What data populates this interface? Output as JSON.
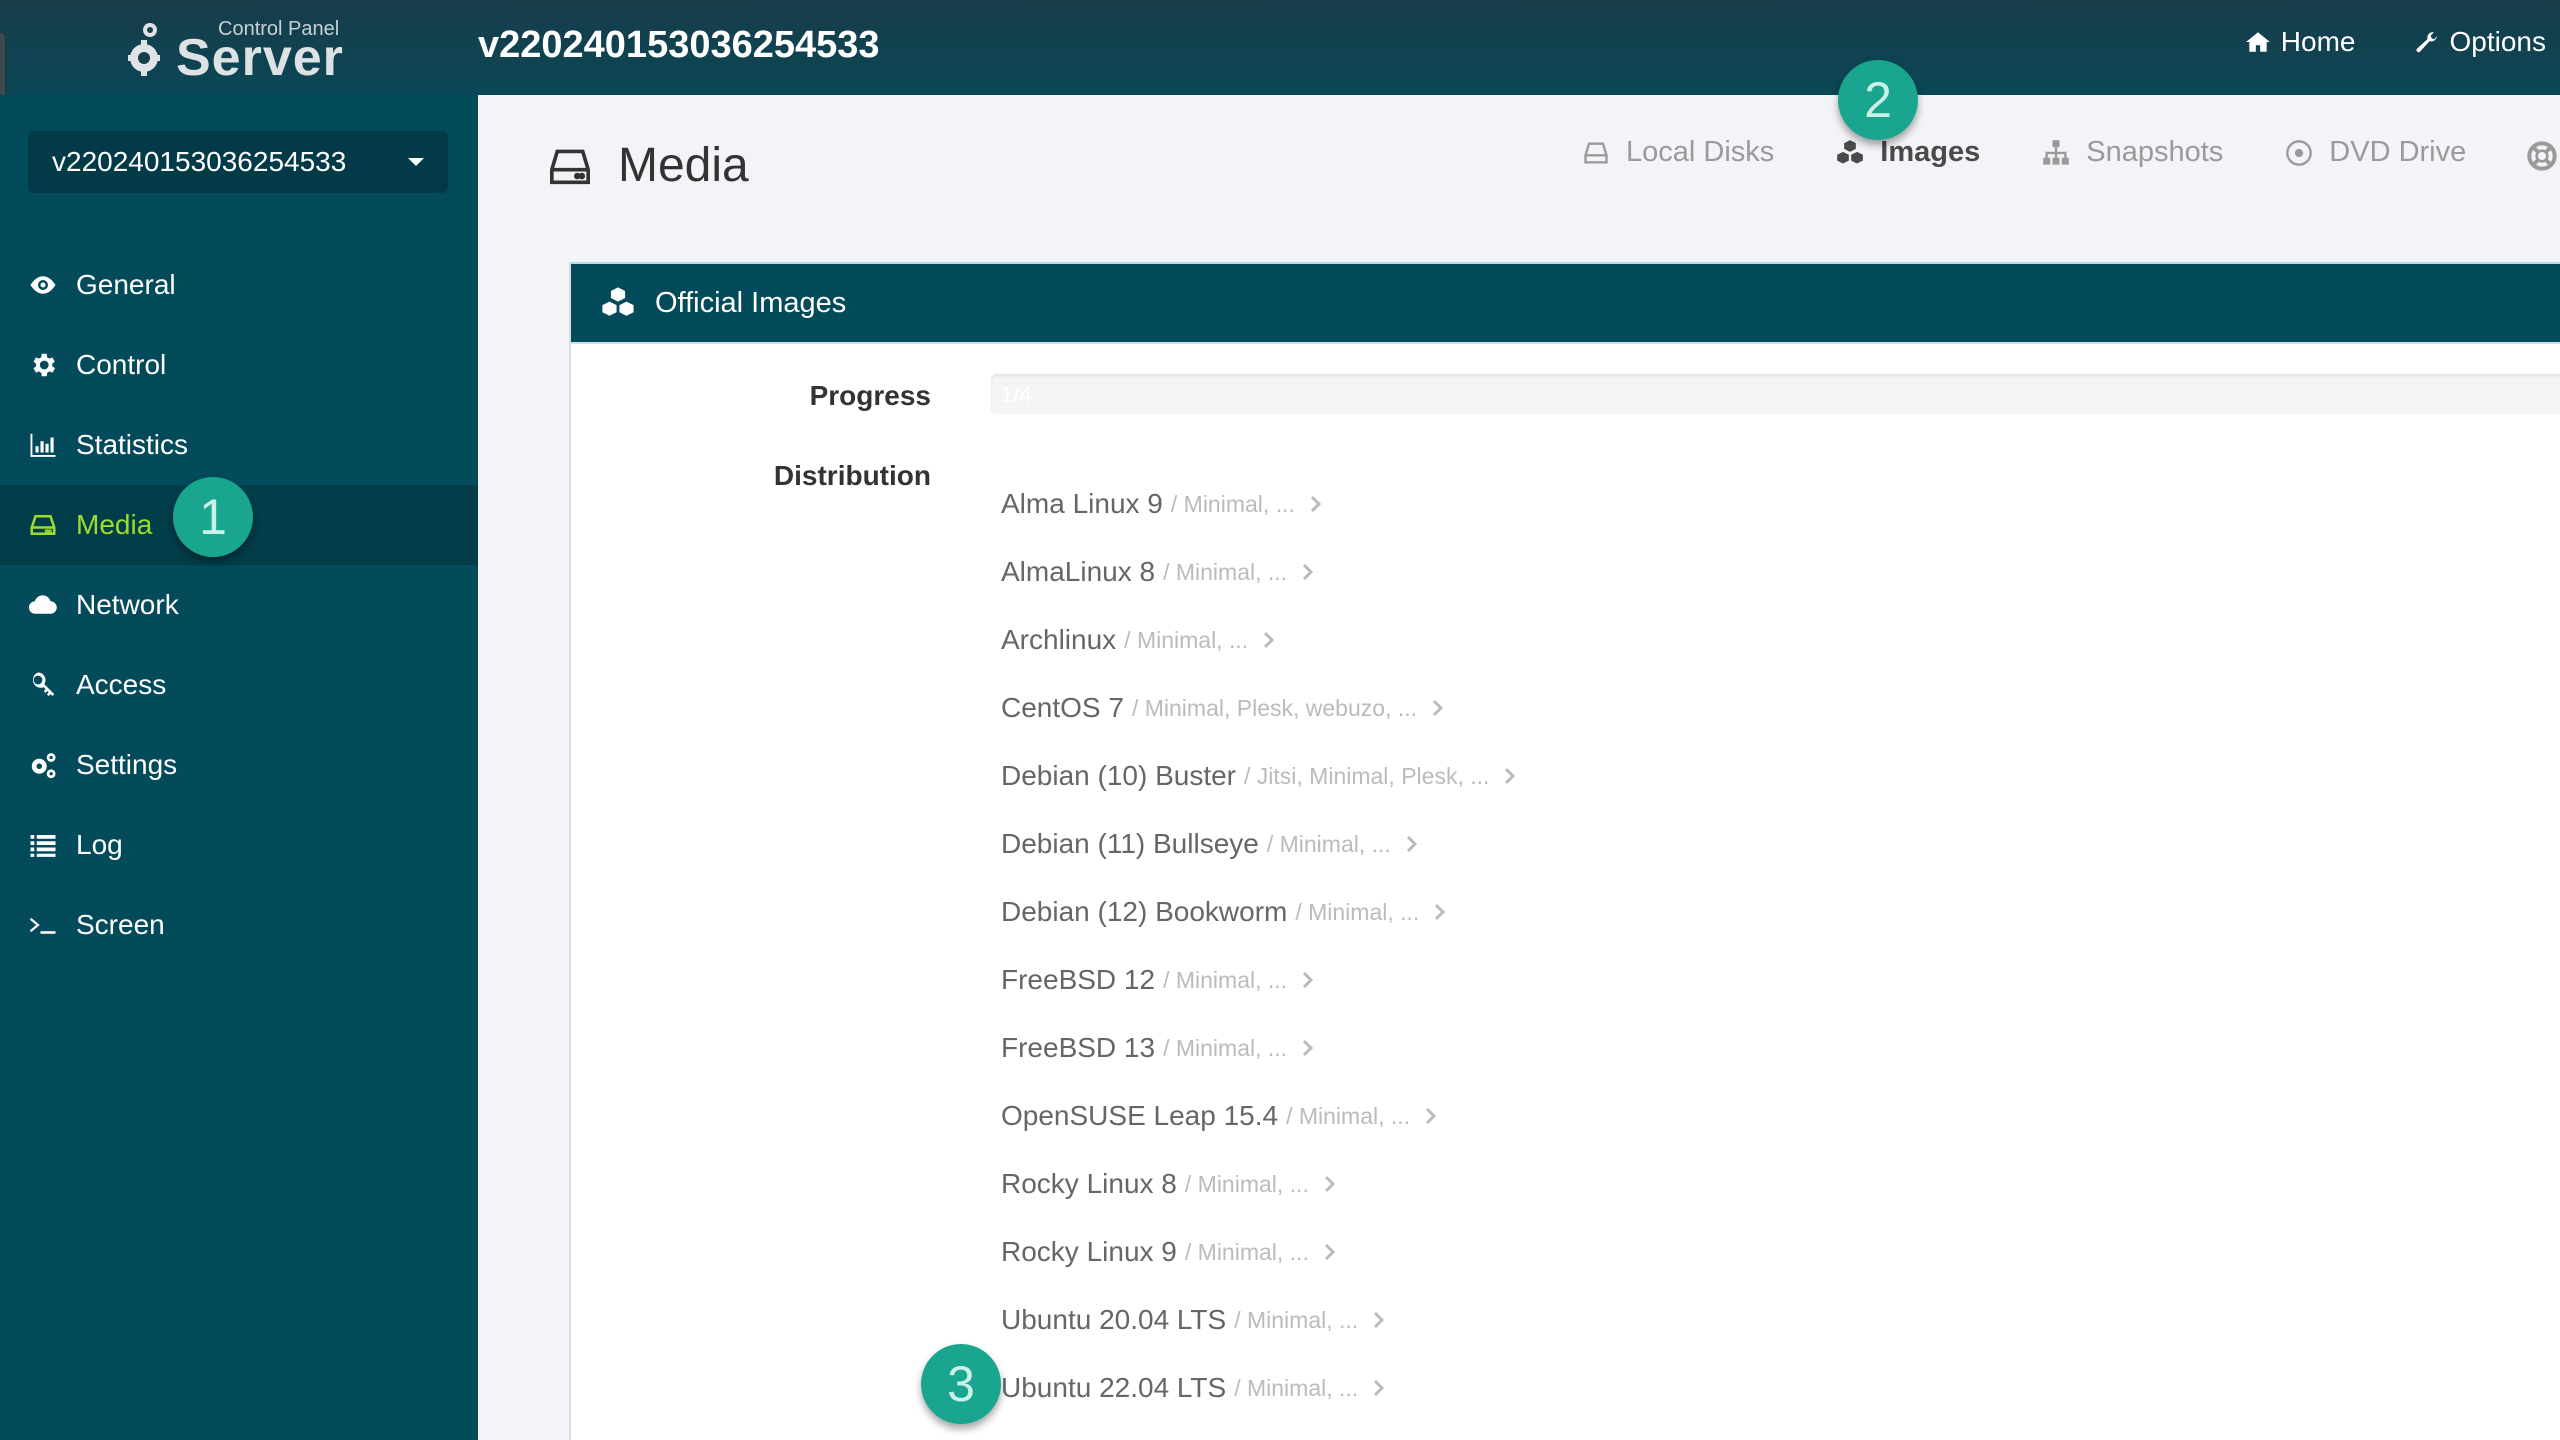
{
  "header": {
    "logo": {
      "subtitle": "Control Panel",
      "title": "Server"
    },
    "server_title": "v220240153036254533",
    "links": [
      {
        "label": "Home",
        "icon": "home-icon"
      },
      {
        "label": "Options",
        "icon": "wrench-icon"
      }
    ]
  },
  "sidebar": {
    "server_select": {
      "value": "v220240153036254533"
    },
    "items": [
      {
        "label": "General",
        "icon": "eye-icon",
        "active": false
      },
      {
        "label": "Control",
        "icon": "gear-icon",
        "active": false
      },
      {
        "label": "Statistics",
        "icon": "bar-chart-icon",
        "active": false
      },
      {
        "label": "Media",
        "icon": "hdd-icon",
        "active": true
      },
      {
        "label": "Network",
        "icon": "cloud-icon",
        "active": false
      },
      {
        "label": "Access",
        "icon": "key-icon",
        "active": false
      },
      {
        "label": "Settings",
        "icon": "gears-icon",
        "active": false
      },
      {
        "label": "Log",
        "icon": "list-icon",
        "active": false
      },
      {
        "label": "Screen",
        "icon": "terminal-icon",
        "active": false
      }
    ]
  },
  "main": {
    "title": "Media",
    "tabs": [
      {
        "label": "Local Disks",
        "icon": "hdd-icon",
        "active": false
      },
      {
        "label": "Images",
        "icon": "cubes-icon",
        "active": true
      },
      {
        "label": "Snapshots",
        "icon": "sitemap-icon",
        "active": false
      },
      {
        "label": "DVD Drive",
        "icon": "disc-icon",
        "active": false
      },
      {
        "label": "",
        "icon": "life-ring-icon",
        "active": false
      }
    ],
    "panel": {
      "title": "Official Images",
      "progress_label": "Progress",
      "progress_text": "1/4",
      "progress_fraction": 0.25,
      "distribution_label": "Distribution",
      "distributions": [
        {
          "name": "Alma Linux 9",
          "variants": "/ Minimal, ..."
        },
        {
          "name": "AlmaLinux 8",
          "variants": "/ Minimal, ..."
        },
        {
          "name": "Archlinux",
          "variants": "/ Minimal, ..."
        },
        {
          "name": "CentOS 7",
          "variants": "/ Minimal, Plesk, webuzo, ..."
        },
        {
          "name": "Debian (10) Buster",
          "variants": "/ Jitsi, Minimal, Plesk, ..."
        },
        {
          "name": "Debian (11) Bullseye",
          "variants": "/ Minimal, ..."
        },
        {
          "name": "Debian (12) Bookworm",
          "variants": "/ Minimal, ..."
        },
        {
          "name": "FreeBSD 12",
          "variants": "/ Minimal, ..."
        },
        {
          "name": "FreeBSD 13",
          "variants": "/ Minimal, ..."
        },
        {
          "name": "OpenSUSE Leap 15.4",
          "variants": "/ Minimal, ..."
        },
        {
          "name": "Rocky Linux 8",
          "variants": "/ Minimal, ..."
        },
        {
          "name": "Rocky Linux 9",
          "variants": "/ Minimal, ..."
        },
        {
          "name": "Ubuntu 20.04 LTS",
          "variants": "/ Minimal, ..."
        },
        {
          "name": "Ubuntu 22.04 LTS",
          "variants": "/ Minimal, ..."
        }
      ]
    }
  },
  "annotations": [
    {
      "label": "1"
    },
    {
      "label": "2"
    },
    {
      "label": "3"
    }
  ],
  "colors": {
    "brand_dark": "#034a5a",
    "active_nav": "#9ddb2c",
    "badge": "#1aa58f"
  }
}
